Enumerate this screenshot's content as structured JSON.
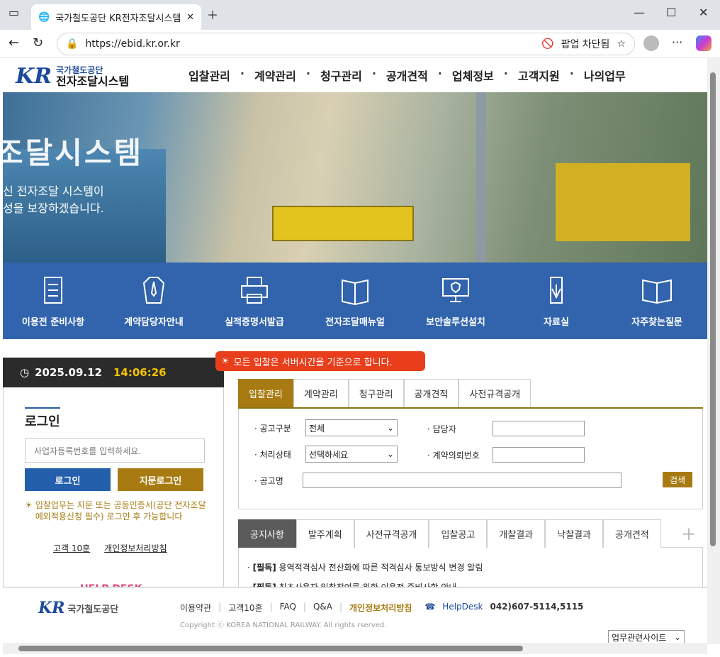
{
  "browser": {
    "tab_title": "국가철도공단 KR전자조달시스템",
    "url": "https://ebid.kr.or.kr",
    "popup_blocked": "팝업 차단됨"
  },
  "header": {
    "logo_line1": "국가철도공단",
    "logo_line2": "전자조달시스템",
    "logo_mark": "KR",
    "nav": [
      "입찰관리",
      "계약관리",
      "청구관리",
      "공개견적",
      "업체정보",
      "고객지원",
      "나의업무"
    ]
  },
  "hero": {
    "title": "조달시스템",
    "line1": "신 전자조달 시스템이",
    "line2": "성을 보장하겠습니다."
  },
  "quick_links": [
    "이용전 준비사항",
    "계약담당자안내",
    "실적증명서발급",
    "전자조달매뉴얼",
    "보안솔루션설치",
    "자료실",
    "자주찾는질문"
  ],
  "clock": {
    "date": "2025.09.12",
    "time": "14:06:26"
  },
  "notice_pill": "모든 입찰은 서버시간을 기준으로 합니다.",
  "login": {
    "title": "로그인",
    "placeholder": "사업자등록번호를 입력하세요.",
    "login_btn": "로그인",
    "finger_btn": "지문로그인",
    "warning": "입찰업무는 지문 또는 공동인증서(공단 전자조달 예외적용신청 필수) 로그인 후 가능합니다",
    "link1": "고객 10훈",
    "link2": "개인정보처리방침",
    "helpdesk": "HELP DESK"
  },
  "search_tabs": [
    "입찰관리",
    "계약관리",
    "청구관리",
    "공개견적",
    "사전규격공개"
  ],
  "form": {
    "l_notice_type": "· 공고구분",
    "v_notice_type": "전체",
    "l_manager": "· 담당자",
    "l_status": "· 처리상태",
    "v_status": "선택하세요",
    "l_contract_no": "· 계약의뢰번호",
    "l_notice_name": "· 공고명",
    "search_btn": "검색"
  },
  "notice_tabs": [
    "공지사항",
    "발주계획",
    "사전규격공개",
    "입찰공고",
    "개찰결과",
    "낙찰결과",
    "공개견적"
  ],
  "notices": [
    {
      "tag": "[필독]",
      "text": "용역적격심사 전산화에 따른 적격심사 통보방식 변경 알림"
    },
    {
      "tag": "[필독]",
      "text": "최초사용자 입찰참여를 위한 이용전 준비사항 안내"
    }
  ],
  "footer": {
    "org": "국가철도공단",
    "links": [
      "이용약관",
      "고객10훈",
      "FAQ",
      "Q&A"
    ],
    "privacy": "개인정보처리방침",
    "helpdesk_label": "HelpDesk",
    "helpdesk_phone": "042)607-5114,5115",
    "copyright": "Copyright ⓒ KOREA NATIONAL RAILWAY. All rights rserved.",
    "site_select": "업무관련사이트"
  }
}
